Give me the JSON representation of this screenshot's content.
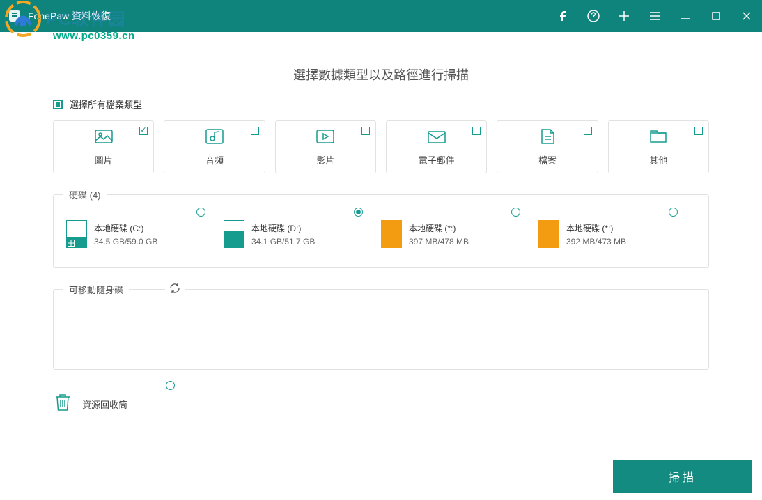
{
  "titlebar": {
    "app_name": "FonePaw 資料恢復"
  },
  "watermark": {
    "url": "www.pc0359.cn",
    "cn": "PC软件园"
  },
  "heading": "選擇數據類型以及路徑進行掃描",
  "select_all_label": "選擇所有檔案類型",
  "types": [
    {
      "label": "圖片",
      "checked": true
    },
    {
      "label": "音頻",
      "checked": false
    },
    {
      "label": "影片",
      "checked": false
    },
    {
      "label": "電子郵件",
      "checked": false
    },
    {
      "label": "檔案",
      "checked": false
    },
    {
      "label": "其他",
      "checked": false
    }
  ],
  "disks": {
    "legend": "硬碟 (4)",
    "items": [
      {
        "name": "本地硬碟 (C:)",
        "size": "34.5 GB/59.0 GB",
        "selected": false,
        "color": "teal",
        "fill_pct": 38,
        "is_system": true
      },
      {
        "name": "本地硬碟 (D:)",
        "size": "34.1 GB/51.7 GB",
        "selected": true,
        "color": "teal",
        "fill_pct": 60,
        "is_system": false
      },
      {
        "name": "本地硬碟 (*:)",
        "size": "397 MB/478 MB",
        "selected": false,
        "color": "orange",
        "fill_pct": 100,
        "is_system": false
      },
      {
        "name": "本地硬碟 (*:)",
        "size": "392 MB/473 MB",
        "selected": false,
        "color": "orange",
        "fill_pct": 100,
        "is_system": false
      }
    ]
  },
  "removable": {
    "legend": "可移動隨身碟"
  },
  "recycle": {
    "label": "資源回收筒"
  },
  "scan_button": "掃描"
}
